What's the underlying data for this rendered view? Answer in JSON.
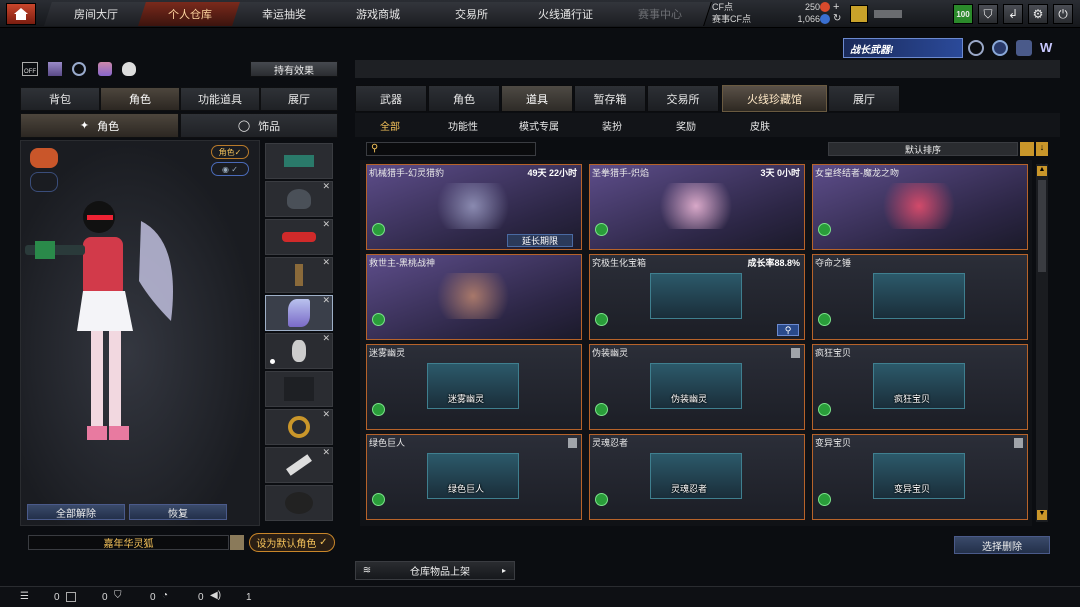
{
  "topnav": {
    "tabs": [
      {
        "label": "房间大厅"
      },
      {
        "label": "个人仓库"
      },
      {
        "label": "幸运抽奖"
      },
      {
        "label": "游戏商城"
      },
      {
        "label": "交易所"
      },
      {
        "label": "火线通行证"
      },
      {
        "label": "赛事中心"
      }
    ],
    "cf_label": "CF点",
    "cf_value": "250",
    "match_cf_label": "赛事CF点",
    "match_cf_value": "1,066",
    "level_badge": "100"
  },
  "promo": {
    "text": "战长武器!"
  },
  "left": {
    "effects_button": "持有效果",
    "main_tabs": [
      {
        "label": "背包"
      },
      {
        "label": "角色"
      },
      {
        "label": "功能道具"
      },
      {
        "label": "展厅"
      }
    ],
    "sub_tabs": [
      {
        "label": "角色"
      },
      {
        "label": "饰品"
      }
    ],
    "toggle_role": "角色",
    "unequip_all": "全部解除",
    "restore": "恢复",
    "character_name": "嘉年华灵狐",
    "set_default": "设为默认角色"
  },
  "right": {
    "tabs": [
      {
        "label": "武器"
      },
      {
        "label": "角色"
      },
      {
        "label": "道具"
      },
      {
        "label": "暂存箱"
      },
      {
        "label": "交易所"
      },
      {
        "label": "火线珍藏馆"
      },
      {
        "label": "展厅"
      }
    ],
    "subtabs": [
      {
        "label": "全部"
      },
      {
        "label": "功能性"
      },
      {
        "label": "模式专属"
      },
      {
        "label": "装扮"
      },
      {
        "label": "奖励"
      },
      {
        "label": "皮肤"
      }
    ],
    "sort_label": "默认排序",
    "select_delete": "选择删除",
    "warehouse_listing": "仓库物品上架",
    "cards": [
      {
        "title": "机械猎手-幻灵猎豹",
        "time": "49天 22小时",
        "extend": "延长期限"
      },
      {
        "title": "圣拳猎手-炽焰",
        "time": "3天 0小时"
      },
      {
        "title": "女皇终结者-魔龙之吻",
        "time": ""
      },
      {
        "title": "救世主-黑桃战神",
        "time": ""
      },
      {
        "title": "究极生化宝箱",
        "time": "成长率88.8%"
      },
      {
        "title": "夺命之锤",
        "time": ""
      },
      {
        "title": "迷雾幽灵",
        "time": "",
        "label": "迷雾幽灵"
      },
      {
        "title": "伪装幽灵",
        "time": "",
        "label": "伪装幽灵"
      },
      {
        "title": "疯狂宝贝",
        "time": "",
        "label": "疯狂宝贝"
      },
      {
        "title": "绿色巨人",
        "time": "",
        "label": "绿色巨人"
      },
      {
        "title": "灵魂忍者",
        "time": "",
        "label": "灵魂忍者"
      },
      {
        "title": "变异宝贝",
        "time": "",
        "label": "变异宝贝"
      }
    ]
  },
  "bottom": {
    "v1": "0",
    "v2": "0",
    "v3": "0",
    "v4": "0",
    "v5": "1"
  }
}
